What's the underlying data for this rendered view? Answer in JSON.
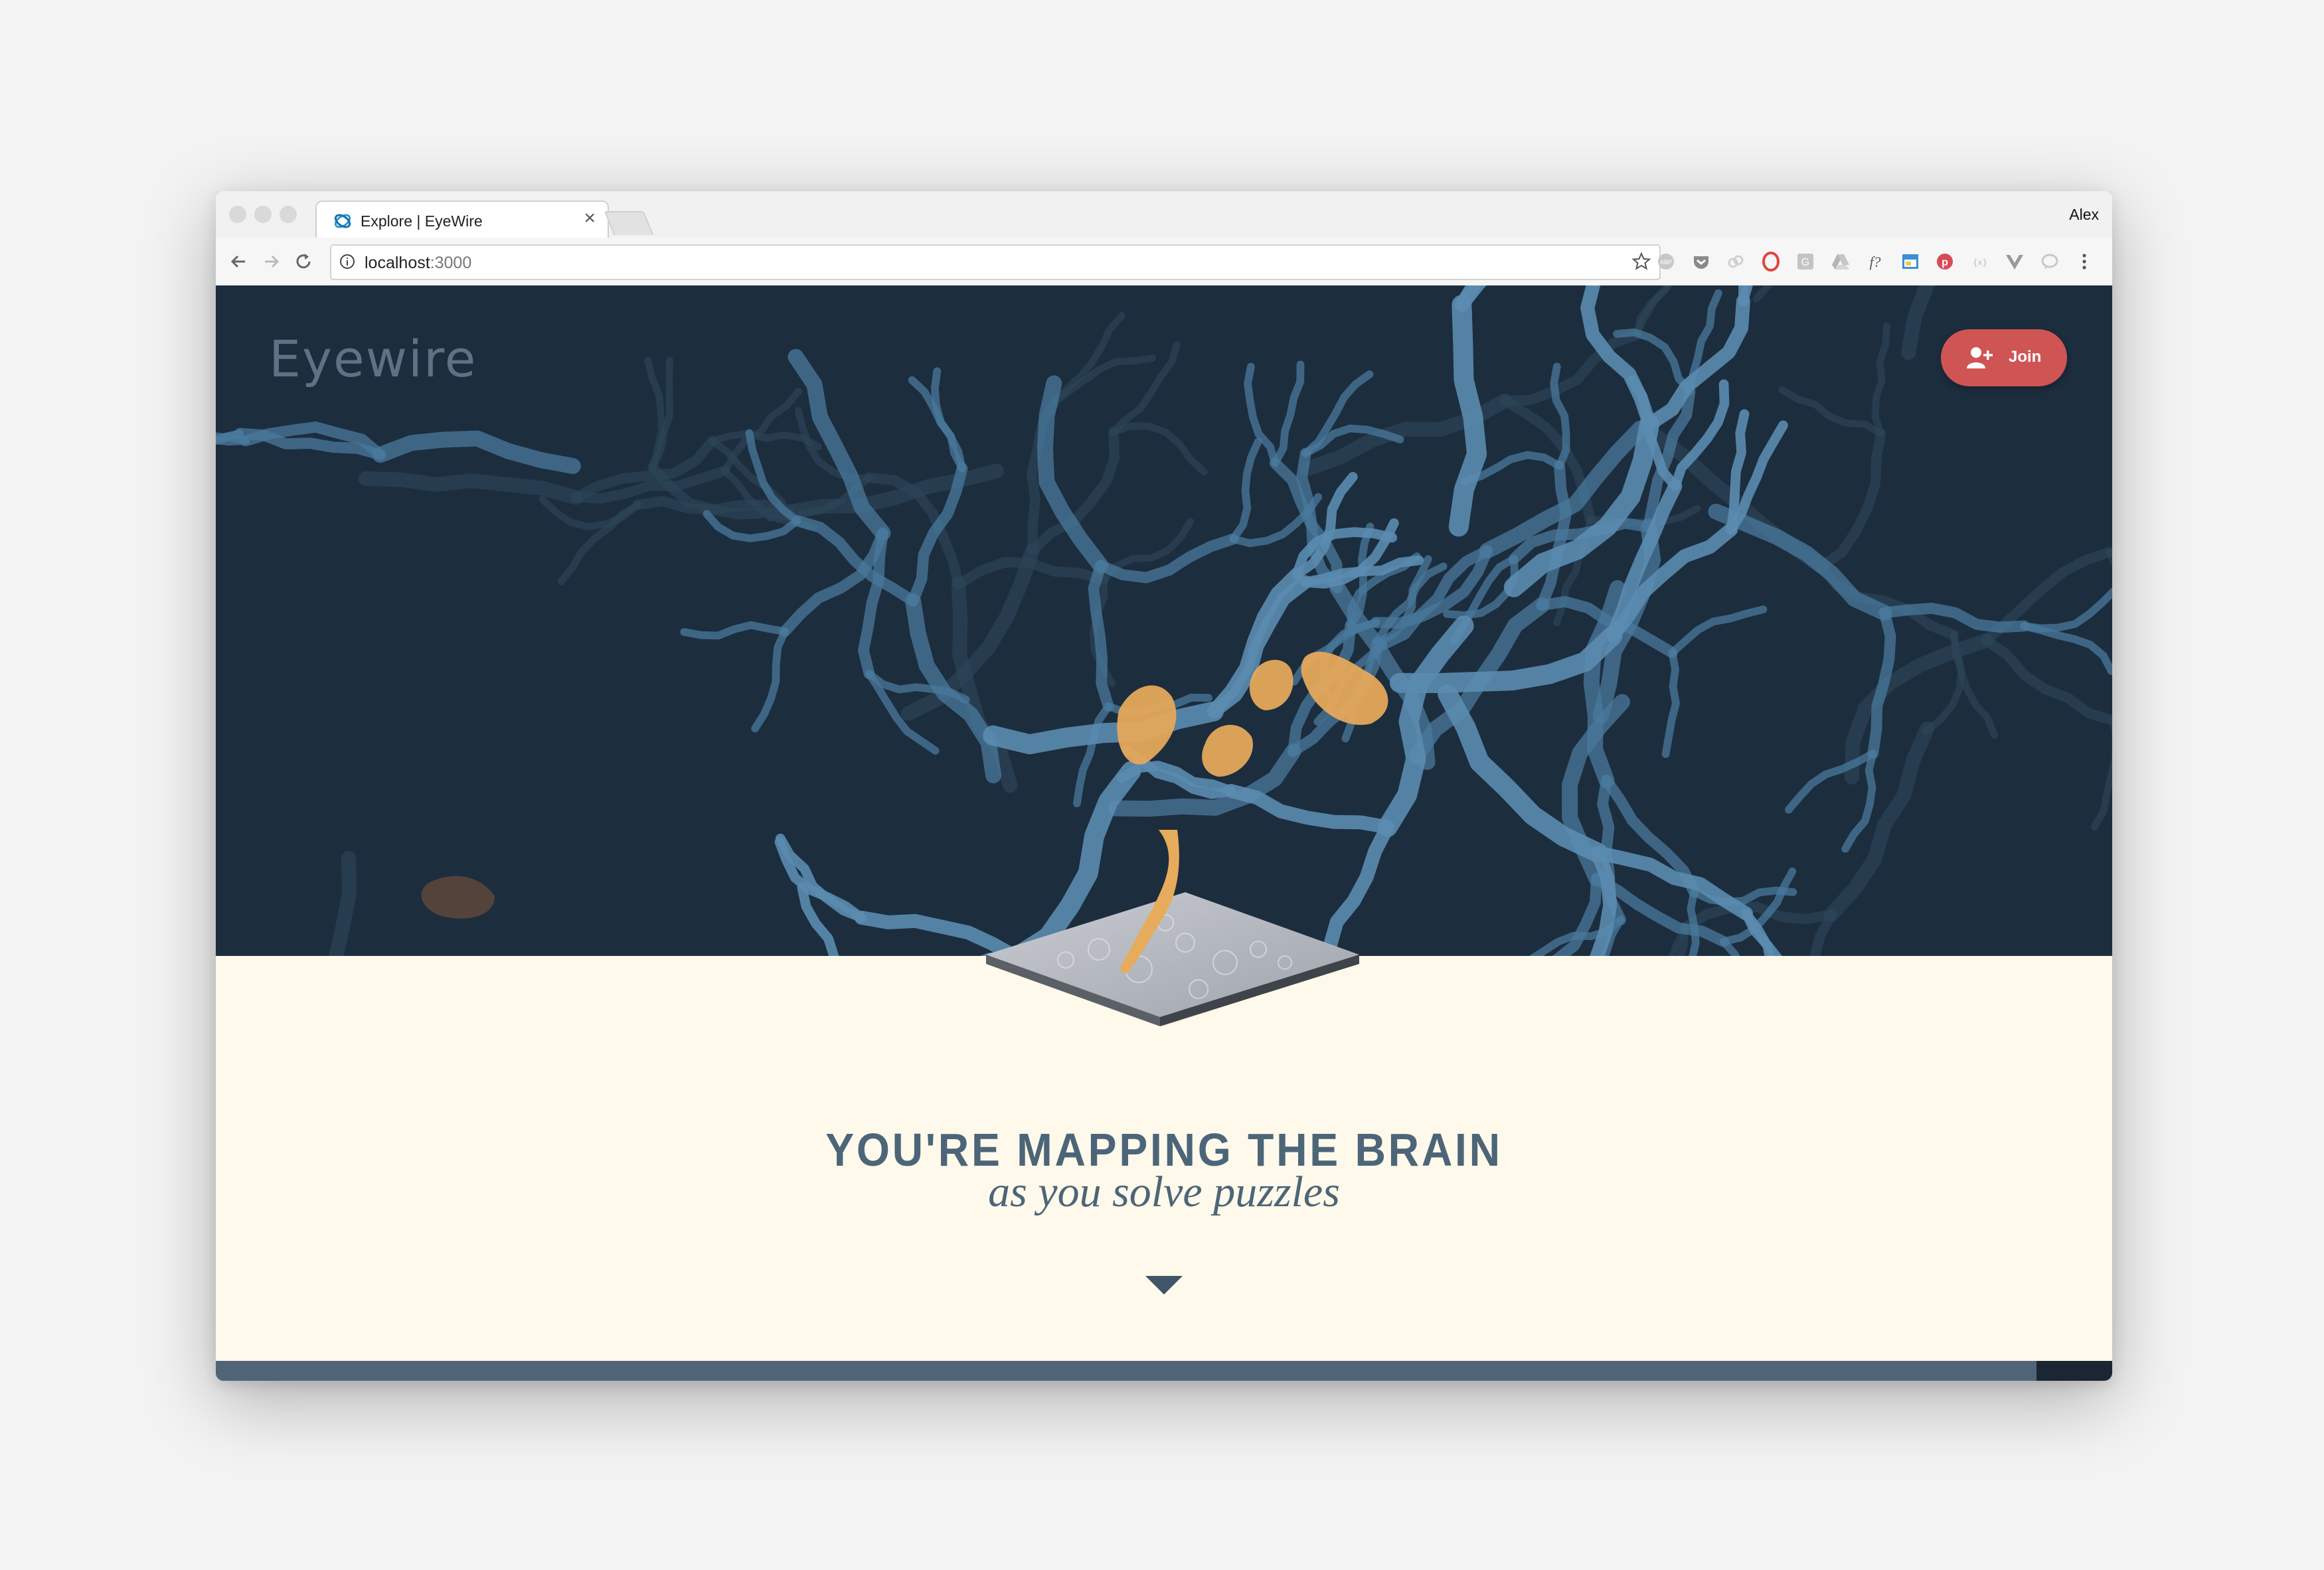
{
  "browser": {
    "tab_title": "Explore | EyeWire",
    "tab_close": "×",
    "profile_name": "Alex",
    "url_host": "localhost",
    "url_port": ":3000"
  },
  "extensions": [
    "abp-icon",
    "pocket-icon",
    "link-icon",
    "opera-icon",
    "grammarly-icon",
    "drive-icon",
    "fonts-icon",
    "window-icon",
    "pinterest-icon",
    "json-icon",
    "vue-icon",
    "chat-icon",
    "menu-icon"
  ],
  "page": {
    "logo": "Eyewire",
    "join_label": "Join",
    "heading": "YOU'RE MAPPING THE BRAIN",
    "subheading": "as you solve puzzles",
    "scroll_progress": 0.96
  },
  "colors": {
    "hero_bg": "#1c2d3e",
    "neuron_blue": "#4a7a9c",
    "neuron_gold": "#e5a85a",
    "join_red": "#cf5555",
    "cream": "#fef9ea",
    "heading": "#4d6578"
  }
}
